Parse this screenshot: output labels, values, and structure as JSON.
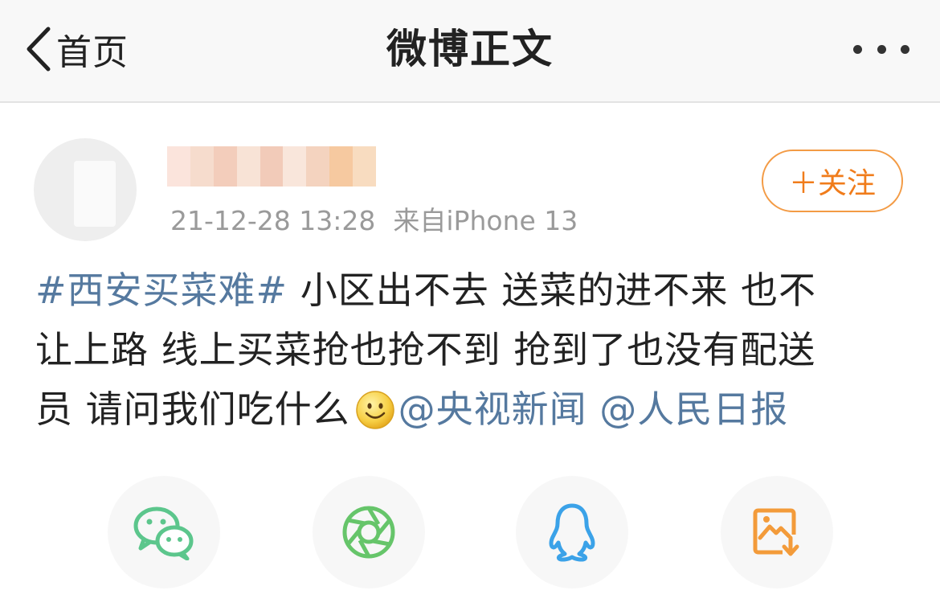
{
  "nav": {
    "back_label": "首页",
    "title": "微博正文"
  },
  "post": {
    "timestamp": "21-12-28 13:28",
    "source": "来自iPhone 13",
    "follow_label": "＋关注",
    "topic": "#西安买菜难#",
    "line1": " 小区出不去 送菜的进不来 也不",
    "line2": "让上路 线上买菜抢也抢不到 抢到了也没有配送",
    "line3": "员 请问我们吃什么",
    "mention1": "@央视新闻",
    "mention2": "@人民日报"
  },
  "share": [
    {
      "icon": "wechat-icon",
      "color": "#5cc68c"
    },
    {
      "icon": "moments-icon",
      "color": "#66c56a"
    },
    {
      "icon": "qq-icon",
      "color": "#3ba2e8"
    },
    {
      "icon": "save-image-icon",
      "color": "#f39b3a"
    }
  ]
}
